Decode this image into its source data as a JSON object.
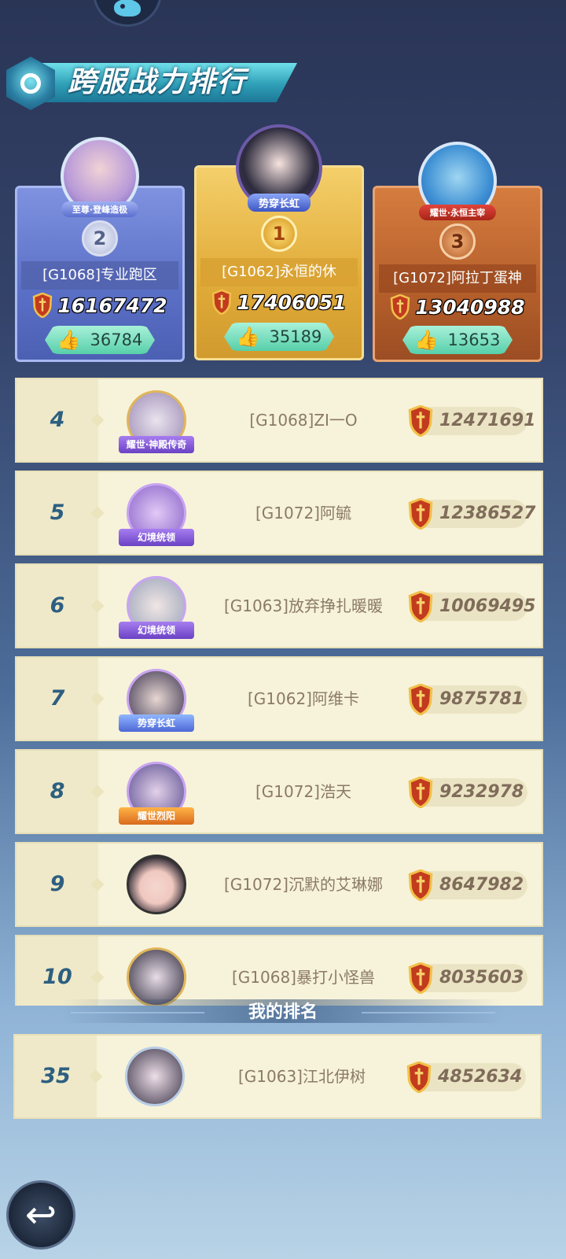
{
  "header": {
    "title": "跨服战力排行"
  },
  "top3": [
    {
      "rank": "2",
      "badge": "至尊·登峰造极",
      "name": "[G1068]专业跑区",
      "power": "16167472",
      "likes": "36784"
    },
    {
      "rank": "1",
      "badge": "势穿长虹",
      "name": "[G1062]永恒的休",
      "power": "17406051",
      "likes": "35189"
    },
    {
      "rank": "3",
      "badge": "耀世·永恒主宰",
      "name": "[G1072]阿拉丁蛋神",
      "power": "13040988",
      "likes": "13653"
    }
  ],
  "list": [
    {
      "rank": "4",
      "badge": "耀世·神殿传奇",
      "name": "[G1068]ZI一O",
      "power": "12471691"
    },
    {
      "rank": "5",
      "badge": "幻境统领",
      "name": "[G1072]阿毓",
      "power": "12386527"
    },
    {
      "rank": "6",
      "badge": "幻境统领",
      "name": "[G1063]放弃挣扎暖暖",
      "power": "10069495"
    },
    {
      "rank": "7",
      "badge": "势穿长虹",
      "name": "[G1062]阿维卡",
      "power": "9875781"
    },
    {
      "rank": "8",
      "badge": "耀世烈阳",
      "name": "[G1072]浩天",
      "power": "9232978"
    },
    {
      "rank": "9",
      "badge": "",
      "name": "[G1072]沉默的艾琳娜",
      "power": "8647982"
    },
    {
      "rank": "10",
      "badge": "",
      "name": "[G1068]暴打小怪兽",
      "power": "8035603"
    }
  ],
  "my_rank": {
    "label": "我的排名",
    "rank": "35",
    "name": "[G1063]江北伊树",
    "power": "4852634"
  },
  "icons": {
    "back": "back-arrow-icon",
    "power": "shield-icon",
    "like": "thumbs-up-icon"
  },
  "colors": {
    "rank1": "#e9b84a",
    "rank2": "#7f95de",
    "rank3": "#c56c34",
    "row_bg": "#f7f3da"
  }
}
